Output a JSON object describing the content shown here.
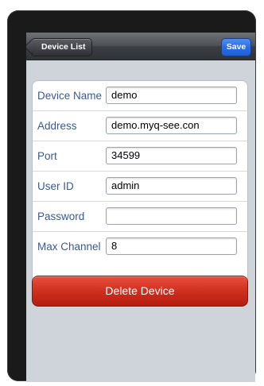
{
  "navbar": {
    "back_label": "Device List",
    "save_label": "Save"
  },
  "form": {
    "fields": [
      {
        "label": "Device Name",
        "value": "demo"
      },
      {
        "label": "Address",
        "value": "demo.myq-see.con"
      },
      {
        "label": "Port",
        "value": "34599"
      },
      {
        "label": "User ID",
        "value": "admin"
      },
      {
        "label": "Password",
        "value": ""
      },
      {
        "label": "Max Channel",
        "value": "8"
      }
    ]
  },
  "delete_label": "Delete Device",
  "colors": {
    "label_text": "#3b5a8a",
    "save_button": "#2a6de6",
    "delete_button": "#cf2f1f"
  }
}
